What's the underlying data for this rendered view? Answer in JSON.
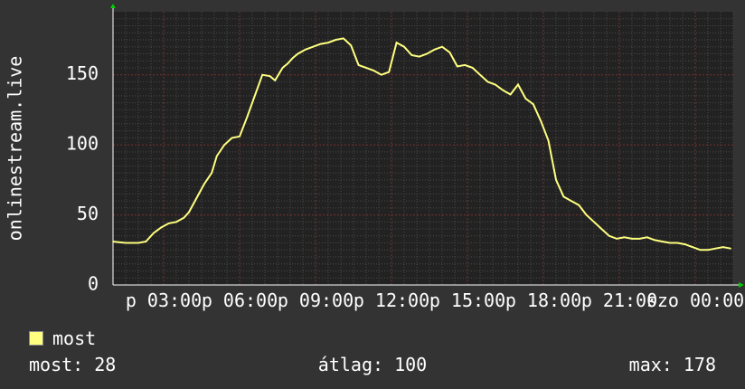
{
  "chart_data": {
    "type": "line",
    "ylabel": "onlinestream.live",
    "ylim": [
      0,
      195
    ],
    "yticks": [
      "0",
      "50",
      "100",
      "150"
    ],
    "ytick_values": [
      0,
      50,
      100,
      150
    ],
    "xticks": [
      "p 03:00",
      "p 06:00",
      "p 09:00",
      "p 12:00",
      "p 15:00",
      "p 18:00",
      "p 21:00",
      "szo 00:00"
    ],
    "xtick_hours": [
      3,
      6,
      9,
      12,
      15,
      18,
      21,
      24
    ],
    "xlim_hours": [
      1.0,
      25.5
    ],
    "grid": true,
    "series": [
      {
        "name": "most",
        "color": "#ffff80",
        "x_hours": [
          1.0,
          1.5,
          2.0,
          2.3,
          2.6,
          2.9,
          3.2,
          3.5,
          3.8,
          4.0,
          4.3,
          4.6,
          4.9,
          5.1,
          5.4,
          5.7,
          6.0,
          6.3,
          6.6,
          6.9,
          7.2,
          7.4,
          7.7,
          7.9,
          8.1,
          8.3,
          8.6,
          8.9,
          9.2,
          9.5,
          9.8,
          10.1,
          10.4,
          10.7,
          11.0,
          11.3,
          11.6,
          11.9,
          12.2,
          12.5,
          12.8,
          13.1,
          13.4,
          13.7,
          14.0,
          14.3,
          14.6,
          14.9,
          15.2,
          15.5,
          15.8,
          16.1,
          16.4,
          16.7,
          17.0,
          17.3,
          17.6,
          17.9,
          18.2,
          18.5,
          18.8,
          19.1,
          19.4,
          19.7,
          20.0,
          20.3,
          20.6,
          20.9,
          21.2,
          21.5,
          21.8,
          22.1,
          22.4,
          22.7,
          23.0,
          23.3,
          23.6,
          23.9,
          24.2,
          24.5,
          24.8,
          25.1,
          25.4
        ],
        "values": [
          31,
          30,
          30,
          31,
          37,
          41,
          44,
          45,
          48,
          52,
          62,
          72,
          80,
          92,
          100,
          105,
          106,
          120,
          135,
          150,
          149,
          146,
          155,
          158,
          162,
          165,
          168,
          170,
          172,
          173,
          175,
          176,
          171,
          157,
          155,
          153,
          150,
          152,
          173,
          170,
          164,
          163,
          165,
          168,
          170,
          166,
          156,
          157,
          155,
          150,
          145,
          143,
          139,
          136,
          143,
          133,
          129,
          117,
          103,
          75,
          63,
          60,
          57,
          50,
          45,
          40,
          35,
          33,
          34,
          33,
          33,
          34,
          32,
          31,
          30,
          30,
          29,
          27,
          25,
          25,
          26,
          27,
          26
        ]
      }
    ]
  },
  "legend": {
    "label": "most"
  },
  "stats": {
    "now": "most: 28",
    "avg": "átlag: 100",
    "max": "max: 178"
  }
}
